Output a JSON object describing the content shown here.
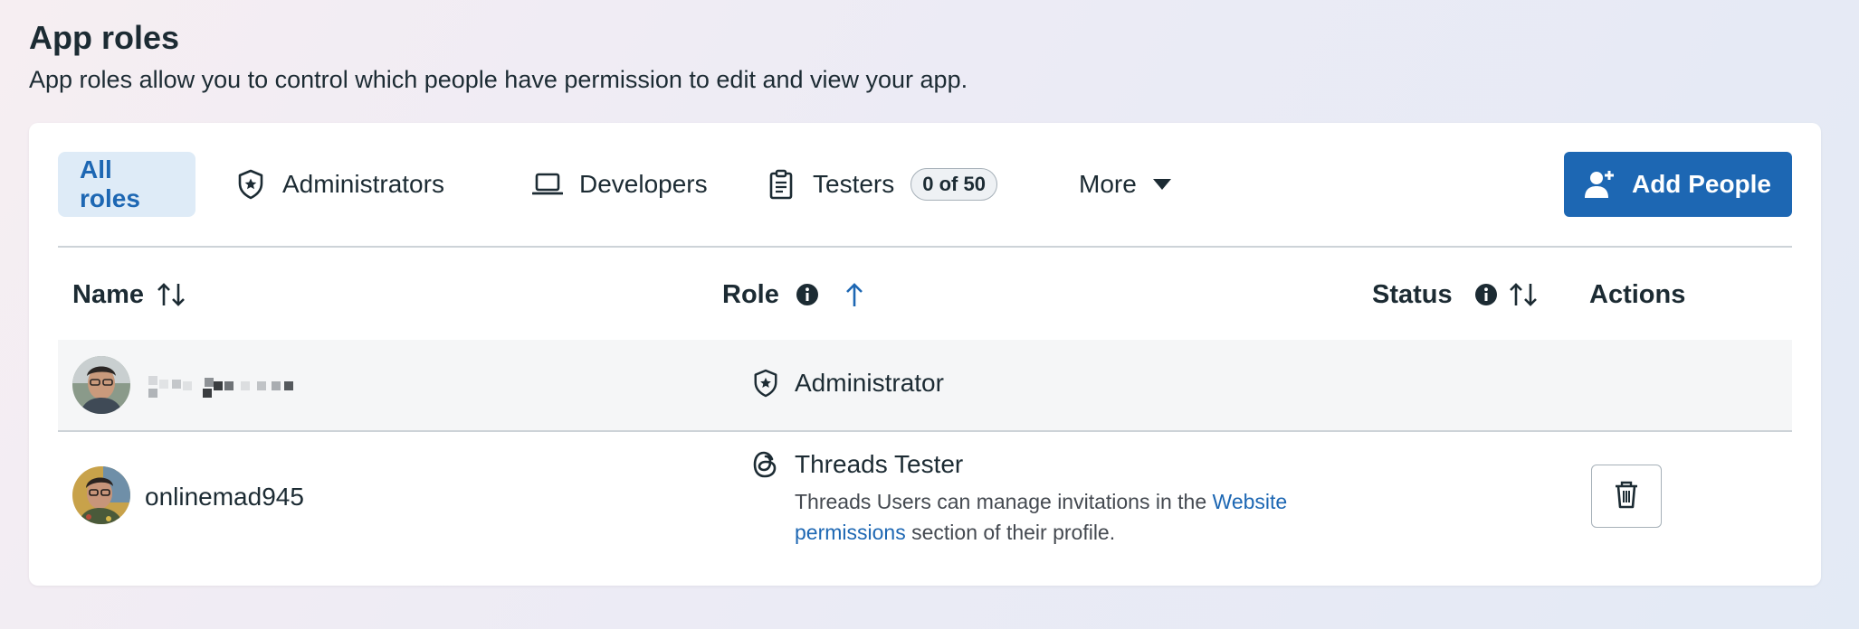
{
  "header": {
    "title": "App roles",
    "subtitle": "App roles allow you to control which people have permission to edit and view your app."
  },
  "tabs": [
    {
      "label": "All roles",
      "active": true
    },
    {
      "label": "Administrators",
      "icon": "shield-star-icon"
    },
    {
      "label": "Developers",
      "icon": "laptop-icon"
    },
    {
      "label": "Testers",
      "icon": "clipboard-icon",
      "badge": "0 of 50"
    },
    {
      "label": "More",
      "icon": "caret-down-icon"
    }
  ],
  "add_button": {
    "label": "Add People",
    "icon": "add-person-icon"
  },
  "table": {
    "columns": {
      "name": "Name",
      "role": "Role",
      "status": "Status",
      "actions": "Actions"
    },
    "rows": [
      {
        "name": "",
        "role": "Administrator",
        "role_icon": "shield-star-icon"
      },
      {
        "name": "onlinemad945",
        "role": "Threads Tester",
        "role_icon": "threads-icon",
        "description_pre": "Threads Users can manage invitations in the ",
        "description_link": "Website permissions",
        "description_post": " section of their profile.",
        "action_icon": "trash-icon"
      }
    ]
  },
  "colors": {
    "accent": "#1d67b3",
    "active_tab_bg": "#deebf7",
    "text": "#1c2b33"
  }
}
